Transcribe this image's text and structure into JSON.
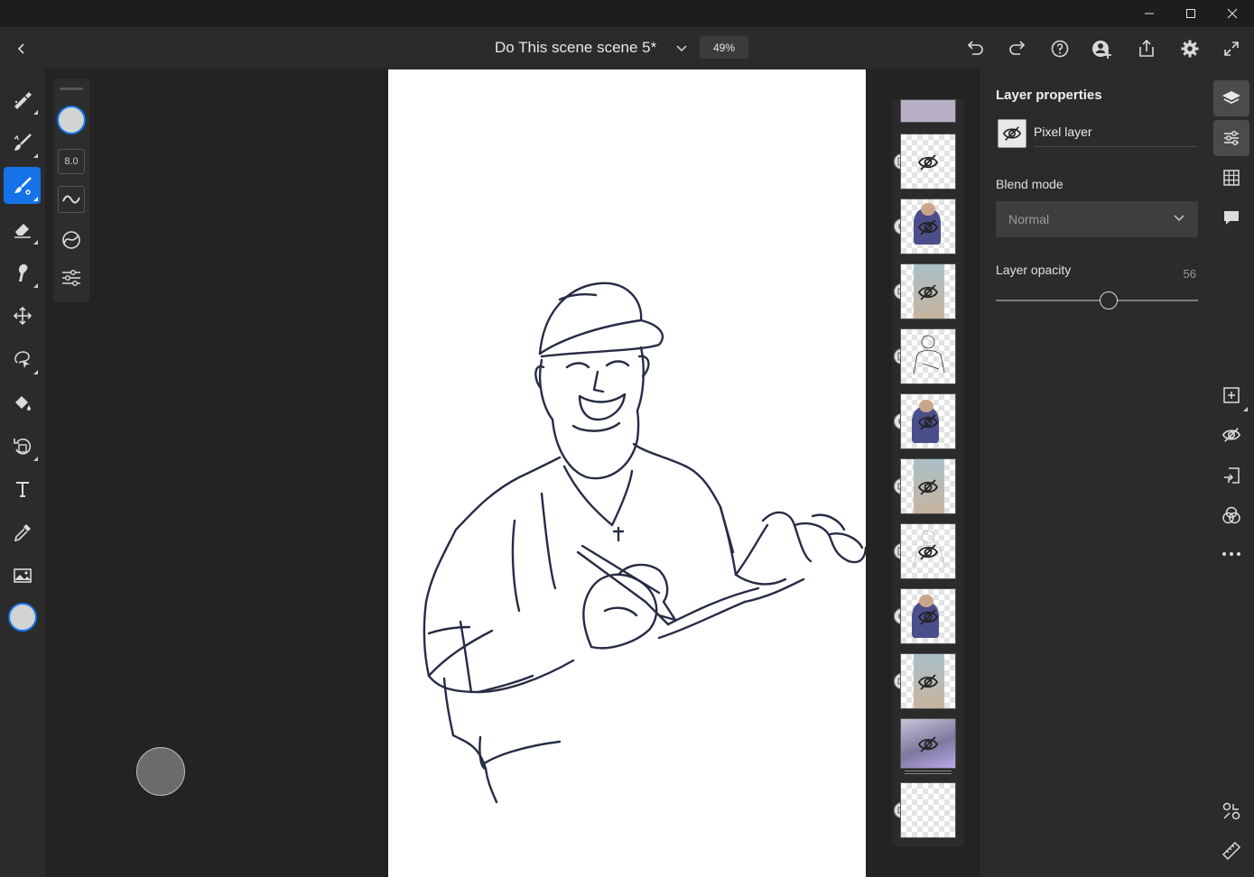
{
  "document": {
    "title": "Do This scene scene 5*",
    "zoom": "49%"
  },
  "window_controls": [
    "minimize-icon",
    "maximize-icon",
    "close-icon"
  ],
  "appbar_icons": [
    "back-icon",
    "undo-icon",
    "redo-icon",
    "help-icon",
    "invite-icon",
    "share-icon",
    "settings-icon",
    "fullscreen-icon"
  ],
  "left_tools": [
    "pixel-brush-icon",
    "live-brush-icon",
    "vector-brush-icon",
    "eraser-icon",
    "smudge-icon",
    "move-icon",
    "lasso-select-icon",
    "fill-icon",
    "transform-icon",
    "type-icon",
    "eyedropper-icon",
    "image-icon",
    "color-swatch"
  ],
  "active_tool": "vector-brush-icon",
  "brush_panel": {
    "size": "8.0",
    "color": "#d3d3d3"
  },
  "layer_properties": {
    "heading": "Layer properties",
    "layer_type": "Pixel layer",
    "blend_mode_label": "Blend mode",
    "blend_mode_value": "Normal",
    "opacity_label": "Layer opacity",
    "opacity_value": "56",
    "opacity_fraction": 0.56
  },
  "layers_count": 12,
  "right_rail_icons": [
    "layers-icon",
    "layer-properties-icon",
    "grid-icon",
    "comments-icon",
    "add-layer-icon",
    "visibility-icon",
    "import-icon",
    "blend-icon",
    "more-icon",
    "share-layer-icon",
    "ruler-icon"
  ],
  "colors": {
    "accent": "#1473e6",
    "panel": "#2b2b2b",
    "canvas": "#ffffff"
  }
}
